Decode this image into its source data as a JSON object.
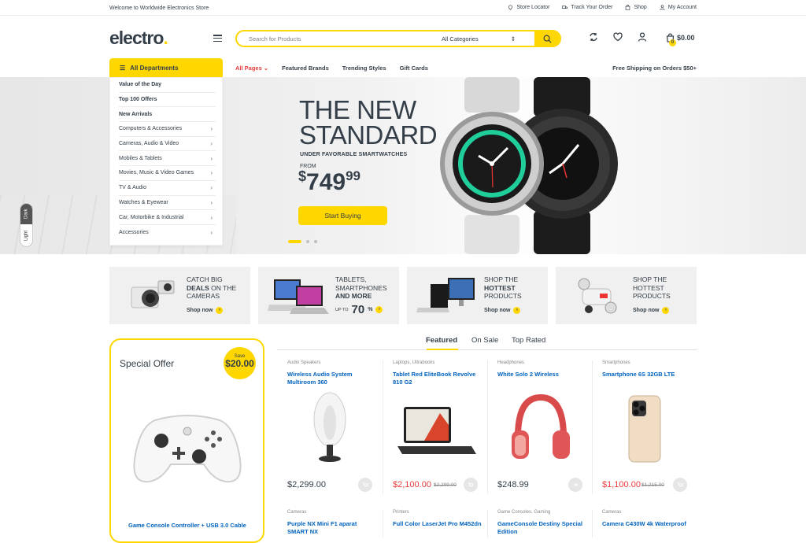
{
  "topbar": {
    "welcome": "Welcome to Worldwide Electronics Store",
    "store_locator": "Store Locator",
    "track_order": "Track Your Order",
    "shop": "Shop",
    "account": "My Account"
  },
  "header": {
    "logo_text": "electro",
    "logo_dot": ".",
    "search_placeholder": "Search for Products",
    "category_select": "All Categories",
    "cart_total": "$0.00",
    "cart_count": "0"
  },
  "nav": {
    "all_departments": "All Departments",
    "links": [
      "All Pages",
      "Featured Brands",
      "Trending Styles",
      "Gift Cards"
    ],
    "free_shipping": "Free Shipping on Orders $50+"
  },
  "departments": [
    {
      "label": "Value of the Day",
      "bold": true
    },
    {
      "label": "Top 100 Offers",
      "bold": true
    },
    {
      "label": "New Arrivals",
      "bold": true
    },
    {
      "label": "Computers & Accessories"
    },
    {
      "label": "Cameras, Audio & Video"
    },
    {
      "label": "Mobiles & Tablets"
    },
    {
      "label": "Movies, Music & Video Games"
    },
    {
      "label": "TV & Audio"
    },
    {
      "label": "Watches & Eyewear"
    },
    {
      "label": "Car, Motorbike & Industrial"
    },
    {
      "label": "Accessories"
    }
  ],
  "hero": {
    "title_line1": "THE NEW",
    "title_line2": "STANDARD",
    "subtitle": "UNDER FAVORABLE SMARTWATCHES",
    "from": "FROM",
    "currency": "$",
    "price_main": "749",
    "price_cents": "99",
    "cta": "Start Buying",
    "active_slide": 1,
    "slide_count": 3
  },
  "theme_toggle": {
    "dark": "Dark",
    "light": "Light"
  },
  "promos": [
    {
      "line1": "CATCH BIG",
      "bold": "DEALS",
      "line2_rest": " ON THE",
      "line3": "CAMERAS",
      "shop": "Shop now"
    },
    {
      "line1": "TABLETS,",
      "line2": "SMARTPHONES",
      "bold": "AND MORE",
      "upto": "UP TO",
      "percent": "70",
      "pct_sign": "%",
      "shop": ""
    },
    {
      "line1": "SHOP THE",
      "bold": "HOTTEST",
      "line3": "PRODUCTS",
      "shop": "Shop now"
    },
    {
      "line1": "SHOP THE",
      "line2": "HOTTEST",
      "line3": "PRODUCTS",
      "shop": "Shop now"
    }
  ],
  "special_offer": {
    "title": "Special Offer",
    "save_label": "Save",
    "save_amount": "$20.00",
    "product_name": "Game Console Controller + USB 3.0 Cable"
  },
  "tabs": [
    "Featured",
    "On Sale",
    "Top Rated"
  ],
  "products": [
    {
      "category": "Audio Speakers",
      "name": "Wireless Audio System Multiroom 360",
      "price": "$2,299.00",
      "old_price": ""
    },
    {
      "category": "Laptops, Ultrabooks",
      "name": "Tablet Red EliteBook Revolve 810 G2",
      "price": "$2,100.00",
      "old_price": "$2,299.00"
    },
    {
      "category": "Headphones",
      "name": "White Solo 2 Wireless",
      "price": "$248.99",
      "old_price": ""
    },
    {
      "category": "Smartphones",
      "name": "Smartphone 6S 32GB LTE",
      "price": "$1,100.00",
      "old_price": "$1,215.00"
    }
  ],
  "products_row2": [
    {
      "category": "Cameras",
      "name": "Purple NX Mini F1 aparat SMART NX"
    },
    {
      "category": "Printers",
      "name": "Full Color LaserJet Pro M452dn"
    },
    {
      "category": "Game Consoles, Gaming",
      "name": "GameConsole Destiny Special Edition"
    },
    {
      "category": "Cameras",
      "name": "Camera C430W 4k Waterproof"
    }
  ],
  "colors": {
    "accent": "#fed700",
    "link": "#0062bd",
    "sale": "#e93b3b",
    "text": "#333e48"
  }
}
